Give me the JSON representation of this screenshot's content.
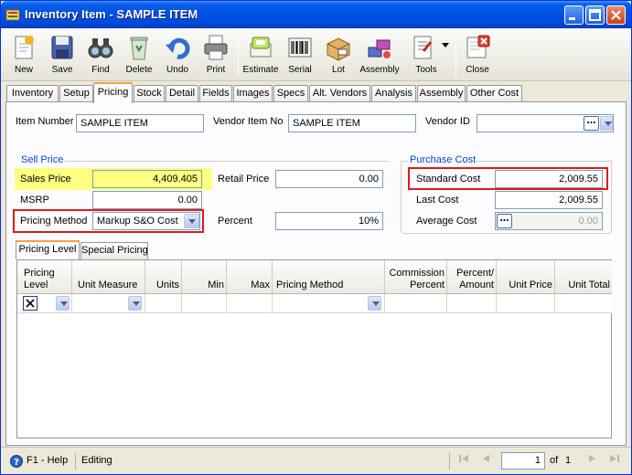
{
  "window": {
    "title": "Inventory Item - SAMPLE ITEM"
  },
  "toolbar": {
    "buttons": [
      {
        "label": "New",
        "icon": "new-document-icon"
      },
      {
        "label": "Save",
        "icon": "floppy-disk-icon"
      },
      {
        "label": "Find",
        "icon": "binoculars-icon"
      },
      {
        "label": "Delete",
        "icon": "recycle-bin-icon"
      },
      {
        "label": "Undo",
        "icon": "undo-arrow-icon"
      },
      {
        "label": "Print",
        "icon": "printer-icon"
      },
      {
        "label": "Estimate",
        "icon": "estimate-icon"
      },
      {
        "label": "Serial",
        "icon": "barcode-icon"
      },
      {
        "label": "Lot",
        "icon": "box-lot-icon"
      },
      {
        "label": "Assembly",
        "icon": "assembly-icon"
      },
      {
        "label": "Tools",
        "icon": "tools-icon"
      },
      {
        "label": "Close",
        "icon": "close-document-icon"
      }
    ]
  },
  "tabs": [
    "Inventory",
    "Setup",
    "Pricing",
    "Stock",
    "Detail",
    "Fields",
    "Images",
    "Specs",
    "Alt. Vendors",
    "Analysis",
    "Assembly",
    "Other Cost"
  ],
  "active_tab": "Pricing",
  "header": {
    "item_number_label": "Item Number",
    "item_number_value": "SAMPLE ITEM",
    "vendor_item_no_label": "Vendor Item No",
    "vendor_item_no_value": "SAMPLE ITEM",
    "vendor_id_label": "Vendor ID",
    "vendor_id_value": ""
  },
  "sell_price": {
    "group_title": "Sell Price",
    "sales_price_label": "Sales Price",
    "sales_price_value": "4,409.405",
    "msrp_label": "MSRP",
    "msrp_value": "0.00",
    "pricing_method_label": "Pricing Method",
    "pricing_method_value": "Markup S&O Cost",
    "retail_price_label": "Retail Price",
    "retail_price_value": "0.00",
    "percent_label": "Percent",
    "percent_value": "10%"
  },
  "purchase_cost": {
    "group_title": "Purchase Cost",
    "standard_cost_label": "Standard Cost",
    "standard_cost_value": "2,009.55",
    "last_cost_label": "Last Cost",
    "last_cost_value": "2,009.55",
    "average_cost_label": "Average Cost",
    "average_cost_value": "0.00"
  },
  "subtabs": [
    "Pricing Level",
    "Special Pricing"
  ],
  "grid": {
    "columns": [
      {
        "l1": "Pricing",
        "l2": "Level"
      },
      {
        "l1": "",
        "l2": "Unit Measure"
      },
      {
        "l1": "",
        "l2": "Units"
      },
      {
        "l1": "",
        "l2": "Min"
      },
      {
        "l1": "",
        "l2": "Max"
      },
      {
        "l1": "",
        "l2": "Pricing Method"
      },
      {
        "l1": "Commission",
        "l2": "Percent"
      },
      {
        "l1": "Percent/",
        "l2": "Amount"
      },
      {
        "l1": "",
        "l2": "Unit Price"
      },
      {
        "l1": "",
        "l2": "Unit Total"
      }
    ]
  },
  "status": {
    "help": "F1 - Help",
    "mode": "Editing",
    "page_value": "1",
    "of_label": "of",
    "page_total": "1"
  },
  "colors": {
    "highlight_yellow": "#ffff80",
    "annotation_red": "#e01a1a",
    "title_blue": "#0050e6",
    "group_title_blue": "#0046d5"
  }
}
